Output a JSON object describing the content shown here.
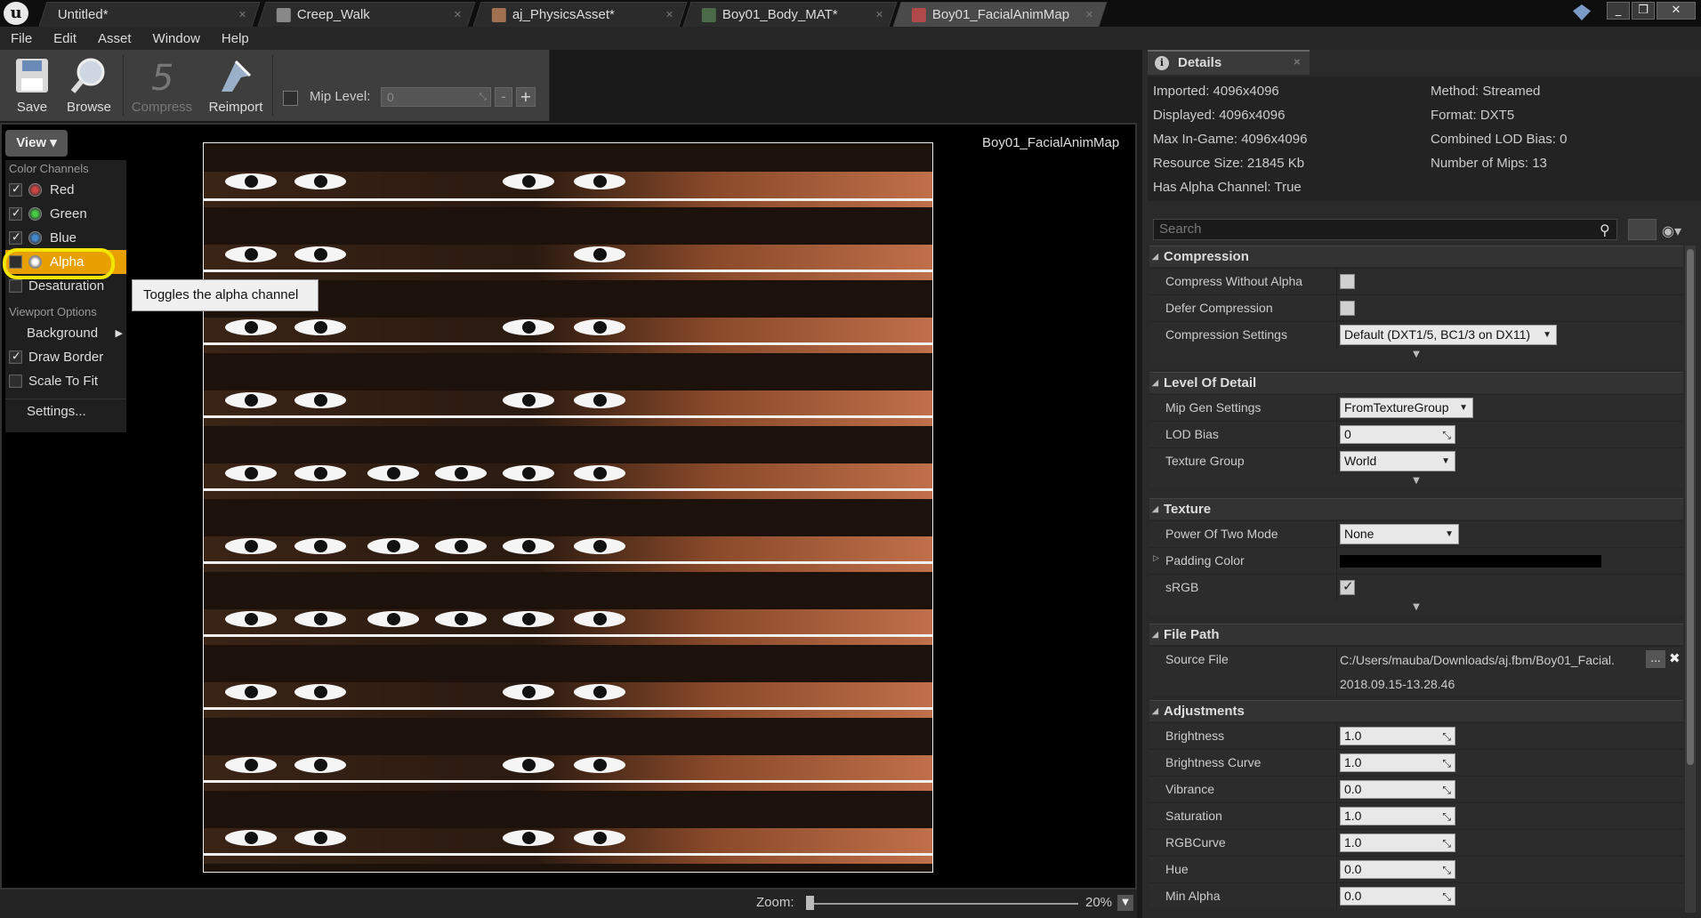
{
  "tabs": [
    {
      "label": "Untitled*",
      "active": false
    },
    {
      "label": "Creep_Walk",
      "active": false
    },
    {
      "label": "aj_PhysicsAsset*",
      "active": false
    },
    {
      "label": "Boy01_Body_MAT*",
      "active": false
    },
    {
      "label": "Boy01_FacialAnimMap",
      "active": true
    }
  ],
  "menu": [
    "File",
    "Edit",
    "Asset",
    "Window",
    "Help"
  ],
  "toolbar": {
    "save": "Save",
    "browse": "Browse",
    "compress": "Compress",
    "reimport": "Reimport",
    "mip_label": "Mip Level:",
    "mip_value": "0",
    "minus": "-",
    "plus": "+"
  },
  "view_button": "View",
  "view_menu": {
    "color_channels_header": "Color Channels",
    "red": "Red",
    "green": "Green",
    "blue": "Blue",
    "alpha": "Alpha",
    "desaturation": "Desaturation",
    "viewport_header": "Viewport Options",
    "background": "Background",
    "draw_border": "Draw Border",
    "scale_to_fit": "Scale To Fit",
    "settings": "Settings..."
  },
  "tooltip": "Toggles the alpha channel",
  "texture_name": "Boy01_FacialAnimMap",
  "zoom": {
    "label": "Zoom:",
    "value": "20%"
  },
  "details": {
    "tab": "Details",
    "info_left": [
      "Imported: 4096x4096",
      "Displayed: 4096x4096",
      "Max In-Game: 4096x4096",
      "Resource Size: 21845 Kb",
      "Has Alpha Channel: True"
    ],
    "info_right": [
      "Method: Streamed",
      "Format: DXT5",
      "Combined LOD Bias: 0",
      "Number of Mips: 13"
    ],
    "search_placeholder": "Search",
    "compression": {
      "title": "Compression",
      "without_alpha": "Compress Without Alpha",
      "defer": "Defer Compression",
      "settings_label": "Compression Settings",
      "settings_value": "Default (DXT1/5, BC1/3 on DX11)"
    },
    "lod": {
      "title": "Level Of Detail",
      "mip_gen_label": "Mip Gen Settings",
      "mip_gen_value": "FromTextureGroup",
      "lod_bias_label": "LOD Bias",
      "lod_bias_value": "0",
      "group_label": "Texture Group",
      "group_value": "World"
    },
    "texture": {
      "title": "Texture",
      "pot_label": "Power Of Two Mode",
      "pot_value": "None",
      "padding_label": "Padding Color",
      "srgb_label": "sRGB"
    },
    "filepath": {
      "title": "File Path",
      "source_label": "Source File",
      "source_value": "C:/Users/mauba/Downloads/aj.fbm/Boy01_Facial.",
      "timestamp": "2018.09.15-13.28.46",
      "browse": "..."
    },
    "adjustments": {
      "title": "Adjustments",
      "rows": [
        {
          "label": "Brightness",
          "value": "1.0"
        },
        {
          "label": "Brightness Curve",
          "value": "1.0"
        },
        {
          "label": "Vibrance",
          "value": "0.0"
        },
        {
          "label": "Saturation",
          "value": "1.0"
        },
        {
          "label": "RGBCurve",
          "value": "1.0"
        },
        {
          "label": "Hue",
          "value": "0.0"
        },
        {
          "label": "Min Alpha",
          "value": "0.0"
        }
      ]
    }
  }
}
